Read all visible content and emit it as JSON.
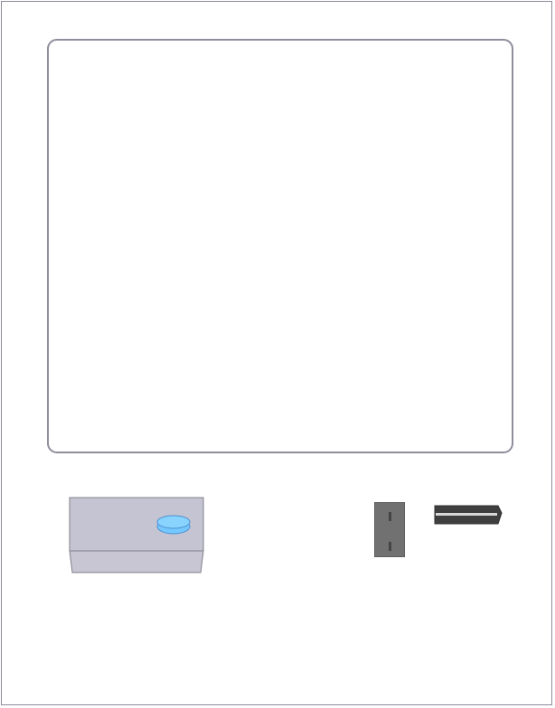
{
  "kiosk": {
    "colors": {
      "frame_border": "#8d8c98",
      "screen_border": "#8f8e9c",
      "device_body": "#c5c4d2",
      "device_button": "#74c8ff",
      "slot_fill": "#717172",
      "card_fill": "#3f3f3f"
    },
    "icons": {
      "device": "scanner-device-icon",
      "device_button": "round-button-icon",
      "slot": "card-slot-icon",
      "card": "card-icon"
    }
  }
}
